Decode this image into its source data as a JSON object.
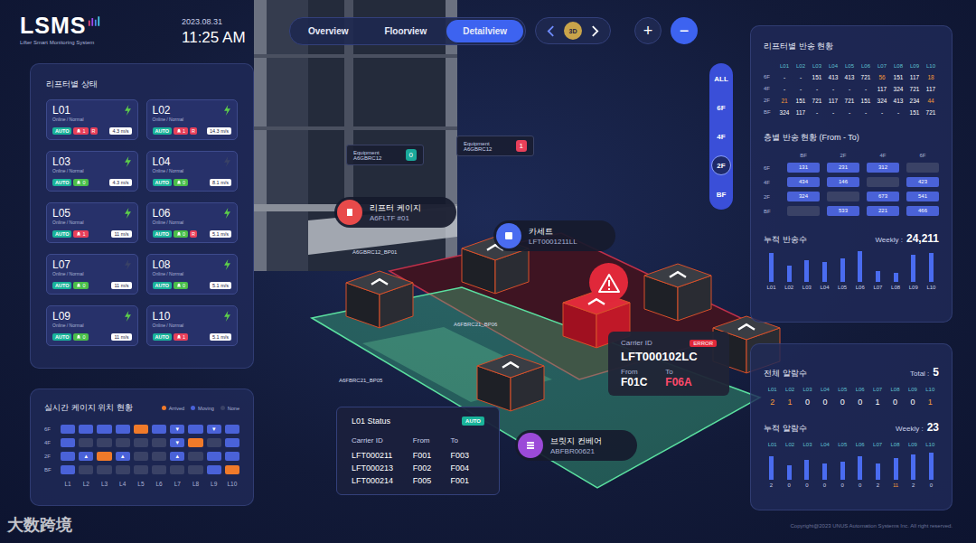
{
  "header": {
    "logo": "LSMS",
    "subtitle": "Lifter Smart Monitoring System",
    "date": "2023.08.31",
    "time": "11:25 AM"
  },
  "tabs": [
    {
      "label": "Overview",
      "selected": false
    },
    {
      "label": "Floorview",
      "selected": false
    },
    {
      "label": "Detailview",
      "selected": true
    }
  ],
  "view_controls": {
    "mode": "3D",
    "zoom_in": "+",
    "zoom_out": "−"
  },
  "floors": [
    {
      "label": "ALL",
      "selected": false
    },
    {
      "label": "6F",
      "selected": false
    },
    {
      "label": "4F",
      "selected": false
    },
    {
      "label": "2F",
      "selected": true
    },
    {
      "label": "BF",
      "selected": false
    }
  ],
  "lifters": {
    "title": "리프터별 상태",
    "items": [
      {
        "name": "L01",
        "status": "Online / Normal",
        "charging": true,
        "mode": "AUTO",
        "alarm": {
          "count": "1",
          "active": true
        },
        "flags": [
          "R"
        ],
        "speed": "4.3 m/s"
      },
      {
        "name": "L02",
        "status": "Online / Normal",
        "charging": true,
        "mode": "AUTO",
        "alarm": {
          "count": "1",
          "active": true
        },
        "flags": [
          "R"
        ],
        "speed": "14.3 m/s"
      },
      {
        "name": "L03",
        "status": "Online / Normal",
        "charging": true,
        "mode": "AUTO",
        "alarm": {
          "count": "0",
          "active": false
        },
        "flags": [],
        "speed": "4.3 m/s"
      },
      {
        "name": "L04",
        "status": "Online / Normal",
        "charging": false,
        "mode": "AUTO",
        "alarm": {
          "count": "0",
          "active": false
        },
        "flags": [],
        "speed": "8.1 m/s"
      },
      {
        "name": "L05",
        "status": "Online / Normal",
        "charging": true,
        "mode": "AUTO",
        "alarm": {
          "count": "1",
          "active": true
        },
        "flags": [],
        "speed": "11 m/s"
      },
      {
        "name": "L06",
        "status": "Online / Normal",
        "charging": true,
        "mode": "AUTO",
        "alarm": {
          "count": "0",
          "active": false
        },
        "flags": [
          "R"
        ],
        "speed": "5.1 m/s"
      },
      {
        "name": "L07",
        "status": "Online / Normal",
        "charging": false,
        "mode": "AUTO",
        "alarm": {
          "count": "0",
          "active": false
        },
        "flags": [],
        "speed": "11 m/s"
      },
      {
        "name": "L08",
        "status": "Online / Normal",
        "charging": true,
        "mode": "AUTO",
        "alarm": {
          "count": "0",
          "active": false
        },
        "flags": [],
        "speed": "5.1 m/s"
      },
      {
        "name": "L09",
        "status": "Online / Normal",
        "charging": true,
        "mode": "AUTO",
        "alarm": {
          "count": "0",
          "active": false
        },
        "flags": [],
        "speed": "11 m/s"
      },
      {
        "name": "L10",
        "status": "Online / Normal",
        "charging": true,
        "mode": "AUTO",
        "alarm": {
          "count": "1",
          "active": true
        },
        "flags": [],
        "speed": "5.1 m/s"
      }
    ]
  },
  "cage_positions": {
    "title": "실시간 케이지 위치 현황",
    "legend": [
      {
        "label": "Arrived",
        "color": "#f07a2a"
      },
      {
        "label": "Moving",
        "color": "#4a62d8"
      },
      {
        "label": "None",
        "color": "#3a4266"
      }
    ],
    "columns": [
      "L1",
      "L2",
      "L3",
      "L4",
      "L5",
      "L6",
      "L7",
      "L8",
      "L9",
      "L10"
    ],
    "rows": [
      {
        "floor": "6F",
        "cells": [
          {
            "state": "Moving",
            "arrow": ""
          },
          {
            "state": "Moving",
            "arrow": ""
          },
          {
            "state": "Moving",
            "arrow": ""
          },
          {
            "state": "Moving",
            "arrow": ""
          },
          {
            "state": "Arrived",
            "arrow": ""
          },
          {
            "state": "Moving",
            "arrow": ""
          },
          {
            "state": "Moving",
            "arrow": "▾"
          },
          {
            "state": "Moving",
            "arrow": ""
          },
          {
            "state": "Moving",
            "arrow": "▾"
          },
          {
            "state": "Moving",
            "arrow": ""
          }
        ]
      },
      {
        "floor": "4F",
        "cells": [
          {
            "state": "Moving",
            "arrow": ""
          },
          {
            "state": "None",
            "arrow": ""
          },
          {
            "state": "None",
            "arrow": ""
          },
          {
            "state": "None",
            "arrow": ""
          },
          {
            "state": "None",
            "arrow": ""
          },
          {
            "state": "None",
            "arrow": ""
          },
          {
            "state": "Moving",
            "arrow": "▾"
          },
          {
            "state": "Arrived",
            "arrow": ""
          },
          {
            "state": "None",
            "arrow": ""
          },
          {
            "state": "Moving",
            "arrow": ""
          }
        ]
      },
      {
        "floor": "2F",
        "cells": [
          {
            "state": "Moving",
            "arrow": ""
          },
          {
            "state": "Moving",
            "arrow": "▴"
          },
          {
            "state": "Arrived",
            "arrow": ""
          },
          {
            "state": "Moving",
            "arrow": "▴"
          },
          {
            "state": "None",
            "arrow": ""
          },
          {
            "state": "None",
            "arrow": ""
          },
          {
            "state": "Moving",
            "arrow": "▴"
          },
          {
            "state": "None",
            "arrow": ""
          },
          {
            "state": "Moving",
            "arrow": ""
          },
          {
            "state": "Moving",
            "arrow": ""
          }
        ]
      },
      {
        "floor": "BF",
        "cells": [
          {
            "state": "Moving",
            "arrow": ""
          },
          {
            "state": "None",
            "arrow": ""
          },
          {
            "state": "None",
            "arrow": ""
          },
          {
            "state": "None",
            "arrow": ""
          },
          {
            "state": "None",
            "arrow": ""
          },
          {
            "state": "None",
            "arrow": ""
          },
          {
            "state": "None",
            "arrow": ""
          },
          {
            "state": "None",
            "arrow": ""
          },
          {
            "state": "Moving",
            "arrow": ""
          },
          {
            "state": "Arrived",
            "arrow": ""
          }
        ]
      }
    ]
  },
  "scene": {
    "equipment": [
      {
        "label": "Equipment",
        "id": "A6GBRC12",
        "count": "0",
        "color": "#1aa89a"
      },
      {
        "label": "Equipment",
        "id": "A6GBRC12",
        "count": "1",
        "color": "#e8405a"
      }
    ],
    "callouts": [
      {
        "title": "리프터 케이지",
        "id": "A6FLTF #01",
        "kind": "cage",
        "color": "#e84a4a"
      },
      {
        "title": "카세트",
        "id": "LFT0001211LL",
        "kind": "cassette",
        "color": "#4a6cf0"
      },
      {
        "title": "브릿지 컨베어",
        "id": "ABFBR00621",
        "kind": "conveyor",
        "color": "#9b4ad8"
      }
    ],
    "port_labels": [
      "A6GBRC12_BP01",
      "A6FBRC21_BP06",
      "A6FBRC21_BP05"
    ],
    "cubes": [
      {
        "error": false
      },
      {
        "error": false
      },
      {
        "error": false
      },
      {
        "error": true
      },
      {
        "error": false
      },
      {
        "error": false
      }
    ],
    "error_card": {
      "label": "Carrier ID",
      "badge": "ERROR",
      "carrier": "LFT000102LC",
      "from_label": "From",
      "to_label": "To",
      "from": "F01C",
      "to": "F06A"
    },
    "status_card": {
      "title": "L01 Status",
      "mode": "AUTO",
      "columns": [
        "Carrier ID",
        "From",
        "To"
      ],
      "rows": [
        [
          "LFT000211",
          "F001",
          "F003"
        ],
        [
          "LFT000213",
          "F002",
          "F004"
        ],
        [
          "LFT000214",
          "F005",
          "F001"
        ]
      ]
    }
  },
  "transfer_by_lifter": {
    "title": "리프터별 반송 현황",
    "columns": [
      "L01",
      "L02",
      "L03",
      "L04",
      "L05",
      "L06",
      "L07",
      "L08",
      "L09",
      "L10"
    ],
    "rows": [
      {
        "floor": "6F",
        "values": [
          {
            "text": "-",
            "alert": false
          },
          {
            "text": "-",
            "alert": false
          },
          {
            "text": "151",
            "alert": false
          },
          {
            "text": "413",
            "alert": false
          },
          {
            "text": "413",
            "alert": false
          },
          {
            "text": "721",
            "alert": false
          },
          {
            "text": "56",
            "alert": true
          },
          {
            "text": "151",
            "alert": false
          },
          {
            "text": "117",
            "alert": false
          },
          {
            "text": "18",
            "alert": true
          }
        ]
      },
      {
        "floor": "4F",
        "values": [
          {
            "text": "-",
            "alert": false
          },
          {
            "text": "-",
            "alert": false
          },
          {
            "text": "-",
            "alert": false
          },
          {
            "text": "-",
            "alert": false
          },
          {
            "text": "-",
            "alert": false
          },
          {
            "text": "-",
            "alert": false
          },
          {
            "text": "117",
            "alert": false
          },
          {
            "text": "324",
            "alert": false
          },
          {
            "text": "721",
            "alert": false
          },
          {
            "text": "117",
            "alert": false
          }
        ]
      },
      {
        "floor": "2F",
        "values": [
          {
            "text": "21",
            "alert": true
          },
          {
            "text": "151",
            "alert": false
          },
          {
            "text": "721",
            "alert": false
          },
          {
            "text": "117",
            "alert": false
          },
          {
            "text": "721",
            "alert": false
          },
          {
            "text": "151",
            "alert": false
          },
          {
            "text": "324",
            "alert": false
          },
          {
            "text": "413",
            "alert": false
          },
          {
            "text": "234",
            "alert": false
          },
          {
            "text": "44",
            "alert": true
          }
        ]
      },
      {
        "floor": "BF",
        "values": [
          {
            "text": "324",
            "alert": false
          },
          {
            "text": "117",
            "alert": false
          },
          {
            "text": "-",
            "alert": false
          },
          {
            "text": "-",
            "alert": false
          },
          {
            "text": "-",
            "alert": false
          },
          {
            "text": "-",
            "alert": false
          },
          {
            "text": "-",
            "alert": false
          },
          {
            "text": "-",
            "alert": false
          },
          {
            "text": "151",
            "alert": false
          },
          {
            "text": "721",
            "alert": false
          }
        ]
      }
    ]
  },
  "transfer_by_floor": {
    "title": "층별 반송 현황 (From - To)",
    "columns": [
      "BF",
      "2F",
      "4F",
      "6F"
    ],
    "rows": [
      {
        "floor": "6F",
        "values": [
          "131",
          "231",
          "312",
          ""
        ]
      },
      {
        "floor": "4F",
        "values": [
          "434",
          "146",
          "",
          "423"
        ]
      },
      {
        "floor": "2F",
        "values": [
          "324",
          "",
          "673",
          "541"
        ]
      },
      {
        "floor": "BF",
        "values": [
          "",
          "533",
          "221",
          "466"
        ]
      }
    ]
  },
  "cumulative_transfers": {
    "title": "누적 반송수",
    "period_label": "Weekly :",
    "total": "24,211",
    "labels": [
      "L01",
      "L02",
      "L03",
      "L04",
      "L05",
      "L06",
      "L07",
      "L08",
      "L09",
      "L10"
    ],
    "values": [
      32,
      18,
      24,
      22,
      26,
      34,
      12,
      10,
      30,
      32
    ]
  },
  "alarms": {
    "title": "전체 알람수",
    "total_label": "Total :",
    "total": "5",
    "columns": [
      "L01",
      "L02",
      "L03",
      "L04",
      "L05",
      "L06",
      "L07",
      "L08",
      "L09",
      "L10"
    ],
    "counts": [
      {
        "text": "2",
        "alert": true
      },
      {
        "text": "1",
        "alert": true
      },
      {
        "text": "0",
        "alert": false
      },
      {
        "text": "0",
        "alert": false
      },
      {
        "text": "0",
        "alert": false
      },
      {
        "text": "0",
        "alert": false
      },
      {
        "text": "1",
        "alert": false
      },
      {
        "text": "0",
        "alert": false
      },
      {
        "text": "0",
        "alert": false
      },
      {
        "text": "1",
        "alert": true
      }
    ]
  },
  "cumulative_alarms": {
    "title": "누적 알람수",
    "period_label": "Weekly :",
    "total": "23",
    "labels": [
      "L01",
      "L02",
      "L03",
      "L04",
      "L05",
      "L06",
      "L07",
      "L08",
      "L09",
      "L10"
    ],
    "values": [
      26,
      16,
      22,
      18,
      20,
      26,
      18,
      24,
      28,
      30
    ],
    "counts": [
      {
        "text": "2",
        "alert": false
      },
      {
        "text": "0",
        "alert": false
      },
      {
        "text": "0",
        "alert": false
      },
      {
        "text": "0",
        "alert": false
      },
      {
        "text": "0",
        "alert": false
      },
      {
        "text": "0",
        "alert": false
      },
      {
        "text": "2",
        "alert": false
      },
      {
        "text": "11",
        "alert": true
      },
      {
        "text": "2",
        "alert": false
      },
      {
        "text": "0",
        "alert": false
      }
    ]
  },
  "footer": {
    "copyright": "Copyright@2023 UNUS Automation Systems Inc. All right reserved."
  },
  "watermark": {
    "text": "大数跨境"
  }
}
